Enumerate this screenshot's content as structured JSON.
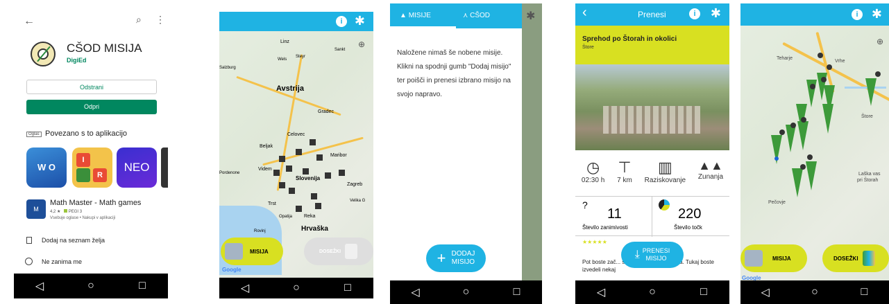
{
  "colors": {
    "accent_cyan": "#1fb3e3",
    "accent_green": "#01875f",
    "accent_lime": "#d8e021",
    "play_green": "#01875f",
    "dark_nav": "#333333"
  },
  "store": {
    "app_name": "CŠOD MISIJA",
    "developer": "DigiEd",
    "uninstall_label": "Odstrani",
    "open_label": "Odpri",
    "ad_tag": "Oglas",
    "related_title": "Povezano s to aplikacijo",
    "neo_label": "NEO",
    "rec_app_name": "Math Master - Math games",
    "rec_app_rating": "4,2 ★",
    "rec_app_pegi": "PEGI 3",
    "rec_app_meta": "Vsebuje oglase • Nakupi v aplikaciji",
    "wishlist_label": "Dodaj na seznam želja",
    "not_interested_label": "Ne zanima me"
  },
  "map1": {
    "labels": [
      "Linz",
      "Wels",
      "Steyr",
      "Sankt",
      "Salzburg",
      "Avstrija",
      "Gradec",
      "Celovec",
      "Beljak",
      "Maribor",
      "Videm",
      "Slovenija",
      "Zagreb",
      "Trst",
      "Pordenone",
      "Opatija",
      "Reka",
      "Hrvaška",
      "Rovinj",
      "Velika G"
    ],
    "mission_label": "MISIJA",
    "achievements_label": "DOSEŽKI",
    "google_label": "Google"
  },
  "drawer": {
    "tab_missions": "MISIJE",
    "tab_csod": "CŠOD",
    "empty_text": "Naložene nimaš še nobene misije. Klikni na spodnji gumb \"Dodaj misijo\" ter poišči in prenesi izbrano misijo na svojo napravo.",
    "add_label_1": "DODAJ",
    "add_label_2": "MISIJO"
  },
  "detail": {
    "header_title": "Prenesi",
    "mission_title": "Sprehod po Štorah in okolici",
    "mission_place": "Štore",
    "duration": "02:30 h",
    "distance": "7 km",
    "type": "Raziskovanje",
    "location": "Zunanja",
    "sights_count": "11",
    "sights_label": "Število zanimivosti",
    "points_count": "220",
    "points_label": "Število točk",
    "stars": "★★★★★",
    "download_label_1": "PRENESI",
    "download_label_2": "MISIJO",
    "desc_text": "Pot boste zač... šole Štore v naselju Lipa. Tukaj boste izvedeli nekaj"
  },
  "map2": {
    "labels": [
      "Teharje",
      "Vrhe",
      "Štore",
      "Pečovje",
      "Laška vas",
      "pri Štorah"
    ],
    "mission_label": "MISIJA",
    "achievements_label": "DOSEŽKI",
    "google_label": "Google"
  },
  "nav": {
    "back": "◁",
    "home": "○",
    "recent": "□"
  }
}
